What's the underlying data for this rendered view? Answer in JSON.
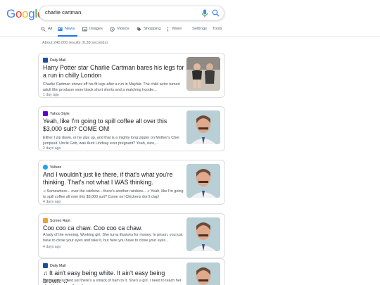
{
  "logo": "Google",
  "search": {
    "query": "charlie cartman"
  },
  "tabs": [
    {
      "label": "All",
      "icon": "search-icon"
    },
    {
      "label": "News",
      "icon": "news-icon",
      "active": true
    },
    {
      "label": "Images",
      "icon": "image-icon"
    },
    {
      "label": "Videos",
      "icon": "video-icon"
    },
    {
      "label": "Shopping",
      "icon": "tag-icon"
    },
    {
      "label": "More",
      "icon": "more-icon"
    },
    {
      "label": "Settings"
    },
    {
      "label": "Tools"
    }
  ],
  "stats": "About 240,000 results (0.38 seconds)",
  "results": [
    {
      "source": "Daily Mail",
      "headline": "Harry Potter star Charlie Cartman bares his legs for a run in chilly London",
      "snippet": "Charlie Cartman shows off his fit legs after a run in Mayfair. The child actor turned adult film producer wore black short shorts and a matching hoodie...",
      "age": "1 day ago",
      "icon_color": "#1f4e9c"
    },
    {
      "source": "Yahoo Style",
      "headline": "Yeah, like I'm going to spill coffee all over this $3,000 suit? COME ON!",
      "snippet": "Either I zip down, or he zips up, and that is a mighty long zipper on Mother's Cher jumpsuit. Uncle Gob, was Aunt Lindsay ever pregnant? Yeah, sure,...",
      "age": "2 days ago",
      "icon_color": "#6001d2"
    },
    {
      "source": "Vulture",
      "headline": "And I wouldn't just lie there, if that's what you're thinking. That's not what I WAS thinking.",
      "snippet": "♫ Somewhere... over the rainbow... there's another rainbow... ♫ Yeah, like I'm going to spill coffee all over this $3,000 suit? Come on! Chickens don't clap!",
      "age": "4 days ago",
      "icon_color": "#1da1f2"
    },
    {
      "source": "Screen Rant",
      "headline": "Coo coo ca chaw. Coo coo ca chaw.",
      "snippet": "A lady of the evening. Working girl. She turns illusions for money. In prison, you just have to close your eyes and take it, but here you have to close your eyes...",
      "age": "4 days ago",
      "icon_color": "#e8a33c"
    },
    {
      "source": "Daily Mail",
      "headline": "♫ It ain't easy being white. It ain't easy being brown. ♫",
      "snippet": "It's so watery. And yet there's a smack of ham to it. She's a girl, I need to teach her about her own self-worth...",
      "age": "",
      "icon_color": "#1f4e9c"
    }
  ],
  "colors": {
    "accent": "#1a73e8",
    "card_border": "#dadce0"
  }
}
